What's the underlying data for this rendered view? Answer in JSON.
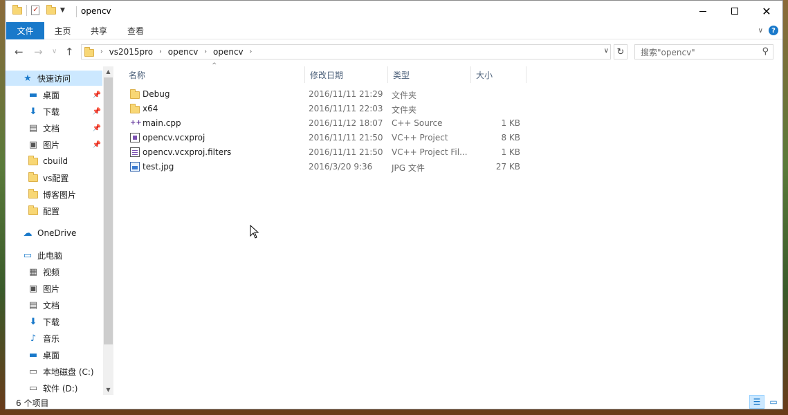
{
  "window": {
    "title": "opencv",
    "quick_access_toolbar": [
      "folder-icon",
      "properties-icon",
      "new-folder-icon",
      "customize-dropdown"
    ]
  },
  "ribbon": {
    "tabs": [
      "文件",
      "主页",
      "共享",
      "查看"
    ]
  },
  "address_bar": {
    "crumbs": [
      "vs2015pro",
      "opencv",
      "opencv"
    ],
    "search_placeholder": "搜索\"opencv\""
  },
  "nav_pane": {
    "quick_access_label": "快速访问",
    "items": [
      {
        "label": "快速访问",
        "icon": "star-icon",
        "selected": true
      },
      {
        "label": "桌面",
        "icon": "desktop-icon",
        "pinned": true
      },
      {
        "label": "下载",
        "icon": "download-icon",
        "pinned": true
      },
      {
        "label": "文档",
        "icon": "document-icon",
        "pinned": true
      },
      {
        "label": "图片",
        "icon": "pictures-icon",
        "pinned": true
      },
      {
        "label": "cbuild",
        "icon": "folder-icon"
      },
      {
        "label": "vs配置",
        "icon": "folder-icon"
      },
      {
        "label": "博客图片",
        "icon": "folder-icon"
      },
      {
        "label": "配置",
        "icon": "folder-icon"
      },
      {
        "label": "OneDrive",
        "icon": "cloud-icon"
      },
      {
        "label": "此电脑",
        "icon": "computer-icon"
      },
      {
        "label": "视频",
        "icon": "video-icon"
      },
      {
        "label": "图片",
        "icon": "pictures-icon"
      },
      {
        "label": "文档",
        "icon": "document-icon"
      },
      {
        "label": "下载",
        "icon": "download-icon"
      },
      {
        "label": "音乐",
        "icon": "music-icon"
      },
      {
        "label": "桌面",
        "icon": "desktop-icon"
      },
      {
        "label": "本地磁盘 (C:)",
        "icon": "drive-icon"
      },
      {
        "label": "软件 (D:)",
        "icon": "drive-icon"
      }
    ]
  },
  "file_list": {
    "columns": [
      "名称",
      "修改日期",
      "类型",
      "大小"
    ],
    "rows": [
      {
        "name": "Debug",
        "date": "2016/11/11 21:29",
        "type": "文件夹",
        "size": "",
        "icon": "folder-icon"
      },
      {
        "name": "x64",
        "date": "2016/11/11 22:03",
        "type": "文件夹",
        "size": "",
        "icon": "folder-icon"
      },
      {
        "name": "main.cpp",
        "date": "2016/11/12 18:07",
        "type": "C++ Source",
        "size": "1 KB",
        "icon": "cpp-file-icon"
      },
      {
        "name": "opencv.vcxproj",
        "date": "2016/11/11 21:50",
        "type": "VC++ Project",
        "size": "8 KB",
        "icon": "vcxproj-file-icon"
      },
      {
        "name": "opencv.vcxproj.filters",
        "date": "2016/11/11 21:50",
        "type": "VC++ Project Fil...",
        "size": "1 KB",
        "icon": "filters-file-icon"
      },
      {
        "name": "test.jpg",
        "date": "2016/3/20 9:36",
        "type": "JPG 文件",
        "size": "27 KB",
        "icon": "image-file-icon"
      }
    ]
  },
  "status_bar": {
    "item_count": "6 个项目"
  },
  "colors": {
    "accent": "#1979ca",
    "selection": "#cce8ff",
    "header_text": "#4c607a",
    "folder": "#f8d775"
  }
}
